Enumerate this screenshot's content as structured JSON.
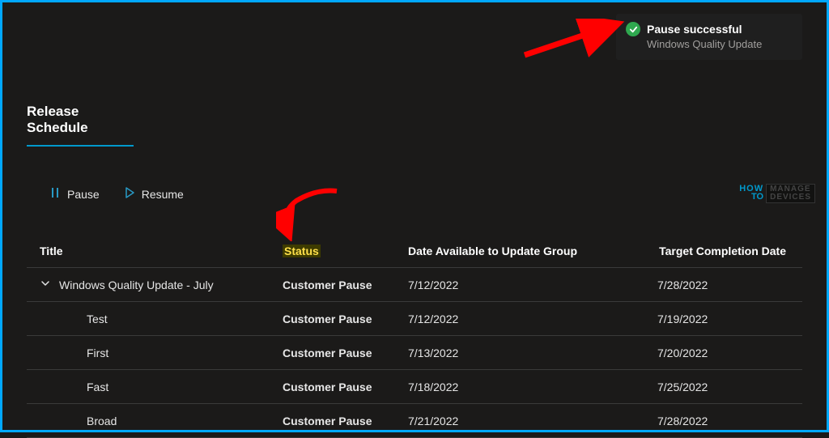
{
  "toast": {
    "title": "Pause successful",
    "subtitle": "Windows Quality Update"
  },
  "section": {
    "title": "Release Schedule"
  },
  "toolbar": {
    "pause": "Pause",
    "resume": "Resume"
  },
  "table": {
    "headers": {
      "title": "Title",
      "status": "Status",
      "date_available": "Date Available to Update Group",
      "target_completion": "Target Completion Date"
    },
    "rows": [
      {
        "title": "Windows Quality Update - July",
        "status": "Customer Pause",
        "available": "7/12/2022",
        "target": "7/28/2022",
        "parent": true
      },
      {
        "title": "Test",
        "status": "Customer Pause",
        "available": "7/12/2022",
        "target": "7/19/2022",
        "parent": false
      },
      {
        "title": "First",
        "status": "Customer Pause",
        "available": "7/13/2022",
        "target": "7/20/2022",
        "parent": false
      },
      {
        "title": "Fast",
        "status": "Customer Pause",
        "available": "7/18/2022",
        "target": "7/25/2022",
        "parent": false
      },
      {
        "title": "Broad",
        "status": "Customer Pause",
        "available": "7/21/2022",
        "target": "7/28/2022",
        "parent": false
      }
    ]
  },
  "watermark": {
    "how": "HOW",
    "to": "TO",
    "manage": "MANAGE",
    "devices": "DEVICES"
  }
}
